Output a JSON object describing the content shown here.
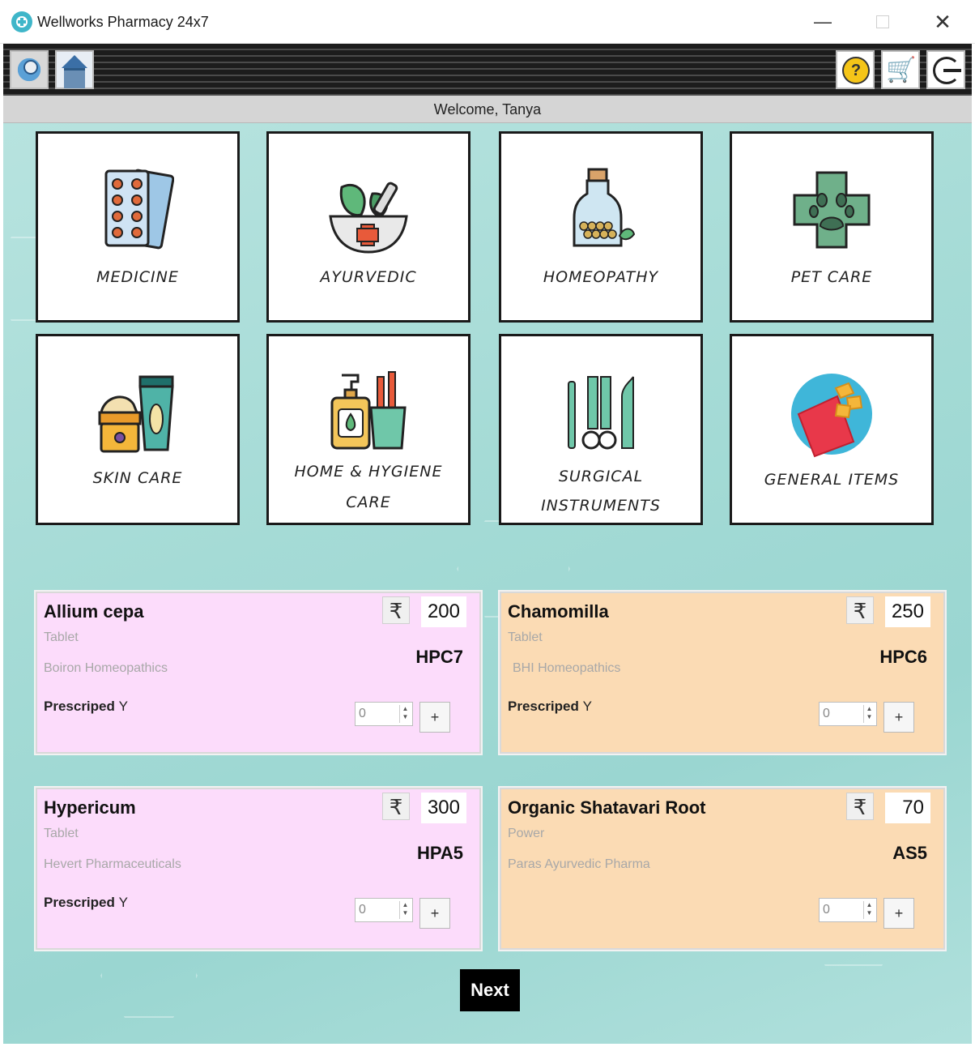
{
  "window": {
    "title": "Wellworks Pharmacy 24x7",
    "minimize": "—",
    "close": "✕"
  },
  "toolbar": {
    "help_glyph": "?",
    "cart_glyph": "🛒"
  },
  "welcome": "Welcome, Tanya",
  "categories": [
    {
      "label": "MEDICINE",
      "icon": "pill-strip-icon"
    },
    {
      "label": "AYURVEDIC",
      "icon": "mortar-pestle-icon"
    },
    {
      "label": "HOMEOPATHY",
      "icon": "pill-bottle-icon"
    },
    {
      "label": "PET CARE",
      "icon": "paw-cross-icon"
    },
    {
      "label": "SKIN CARE",
      "icon": "cream-jar-icon"
    },
    {
      "label": "HOME & HYGIENE",
      "label2": "CARE",
      "icon": "soap-dispenser-icon"
    },
    {
      "label": "SURGICAL",
      "label2": "INSTRUMENTS",
      "icon": "surgical-tools-icon"
    },
    {
      "label": "GENERAL ITEMS",
      "icon": "snack-bag-icon"
    }
  ],
  "products": [
    {
      "name": "Allium cepa",
      "form": "Tablet",
      "maker": "Boiron Homeopathics",
      "code": "HPC7",
      "price": "200",
      "rx_label": "Prescriped",
      "rx_value": "Y",
      "qty": "0",
      "add": "+"
    },
    {
      "name": "Chamomilla",
      "form": "Tablet",
      "maker": "BHI Homeopathics",
      "code": "HPC6",
      "price": "250",
      "rx_label": "Prescriped",
      "rx_value": "Y",
      "qty": "0",
      "add": "+"
    },
    {
      "name": "Hypericum",
      "form": "Tablet",
      "maker": "Hevert Pharmaceuticals",
      "code": "HPA5",
      "price": "300",
      "rx_label": "Prescriped",
      "rx_value": "Y",
      "qty": "0",
      "add": "+"
    },
    {
      "name": "Organic Shatavari Root",
      "form": "Power",
      "maker": "Paras Ayurvedic Pharma",
      "code": "AS5",
      "price": "70",
      "qty": "0",
      "add": "+"
    }
  ],
  "currency_symbol": "₹",
  "next_label": "Next",
  "colors": {
    "homeopathy_card": "#fcdcfb",
    "ayurvedic_card": "#fbdbb4",
    "background": "#a5dbd6"
  }
}
